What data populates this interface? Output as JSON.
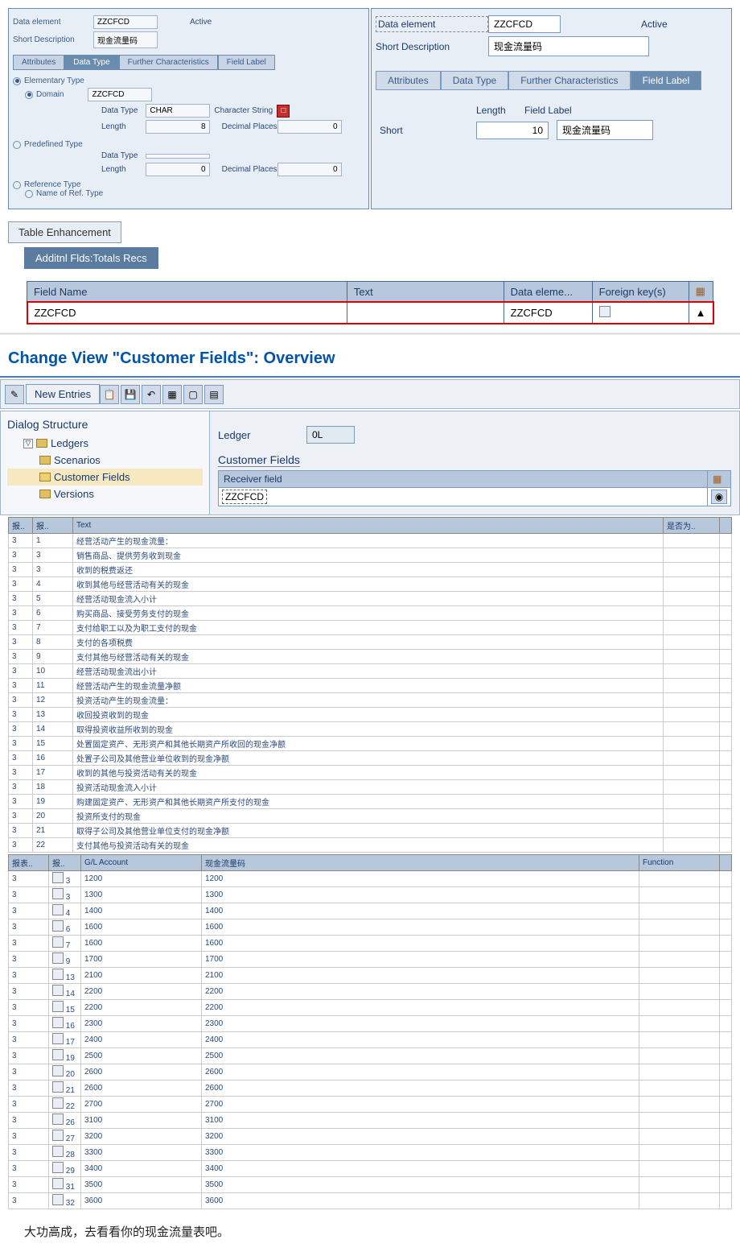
{
  "left_panel": {
    "data_element_label": "Data element",
    "data_element_value": "ZZCFCD",
    "active_label": "Active",
    "short_desc_label": "Short Description",
    "short_desc_value": "现金流量码",
    "tabs": [
      "Attributes",
      "Data Type",
      "Further Characteristics",
      "Field Label"
    ],
    "active_tab_index": 1,
    "elementary_type": "Elementary Type",
    "domain": "Domain",
    "domain_value": "ZZCFCD",
    "data_type_label": "Data Type",
    "data_type_value": "CHAR",
    "data_type_text": "Character String",
    "length_label": "Length",
    "length_value": "8",
    "decimal_places": "Decimal Places",
    "decimal_value": "0",
    "predefined_type": "Predefined Type",
    "pred_length_value": "0",
    "pred_decimal_value": "0",
    "reference_type": "Reference Type",
    "name_ref_type": "Name of Ref. Type"
  },
  "right_panel": {
    "data_element_label": "Data element",
    "data_element_value": "ZZCFCD",
    "active_label": "Active",
    "short_desc_label": "Short Description",
    "short_desc_value": "现金流量码",
    "tabs": [
      "Attributes",
      "Data Type",
      "Further Characteristics",
      "Field Label"
    ],
    "active_tab_index": 3,
    "length_label": "Length",
    "field_label_label": "Field Label",
    "short_label": "Short",
    "short_length": "10",
    "short_value": "现金流量码"
  },
  "table_enhancement": {
    "title": "Table Enhancement",
    "button": "Additnl Flds:Totals Recs",
    "headers": {
      "field_name": "Field Name",
      "text": "Text",
      "data_eleme": "Data eleme...",
      "foreign_key": "Foreign key(s)"
    },
    "row": {
      "field_name": "ZZCFCD",
      "data_element": "ZZCFCD"
    }
  },
  "change_view": {
    "title": "Change View \"Customer Fields\": Overview",
    "new_entries": "New Entries",
    "dialog_structure": "Dialog Structure",
    "ledgers": "Ledgers",
    "scenarios": "Scenarios",
    "customer_fields": "Customer Fields",
    "versions": "Versions",
    "ledger_label": "Ledger",
    "ledger_value": "0L",
    "cf_title": "Customer Fields",
    "receiver_field": "Receiver field",
    "receiver_value": "ZZCFCD"
  },
  "text_table1": {
    "headers": [
      "报..",
      "报..",
      "Text",
      "是否为.."
    ],
    "rows": [
      {
        "c1": "3",
        "c2": "1",
        "text": "经营活动产生的现金流量："
      },
      {
        "c1": "3",
        "c2": "3",
        "text": "销售商品、提供劳务收到现金"
      },
      {
        "c1": "3",
        "c2": "3",
        "text": "收到的税费返还"
      },
      {
        "c1": "3",
        "c2": "4",
        "text": "收到其他与经营活动有关的现金"
      },
      {
        "c1": "3",
        "c2": "5",
        "text": "        经营活动现金流入小计"
      },
      {
        "c1": "3",
        "c2": "6",
        "text": "购买商品、接受劳务支付的现金"
      },
      {
        "c1": "3",
        "c2": "7",
        "text": "支付给职工以及为职工支付的现金"
      },
      {
        "c1": "3",
        "c2": "8",
        "text": "支付的各项税费"
      },
      {
        "c1": "3",
        "c2": "9",
        "text": "支付其他与经营活动有关的现金"
      },
      {
        "c1": "3",
        "c2": "10",
        "text": "        经营活动现金流出小计"
      },
      {
        "c1": "3",
        "c2": "11",
        "text": "    经营活动产生的现金流量净额"
      },
      {
        "c1": "3",
        "c2": "12",
        "text": "投资活动产生的现金流量："
      },
      {
        "c1": "3",
        "c2": "13",
        "text": "收回投资收到的现金"
      },
      {
        "c1": "3",
        "c2": "14",
        "text": "取得投资收益所收到的现金"
      },
      {
        "c1": "3",
        "c2": "15",
        "text": "处置固定资产、无形资产和其他长期资产所收回的现金净额"
      },
      {
        "c1": "3",
        "c2": "16",
        "text": "处置子公司及其他营业单位收到的现金净额"
      },
      {
        "c1": "3",
        "c2": "17",
        "text": "收到的其他与投资活动有关的现金"
      },
      {
        "c1": "3",
        "c2": "18",
        "text": "        投资活动现金流入小计"
      },
      {
        "c1": "3",
        "c2": "19",
        "text": "购建固定资产、无形资产和其他长期资产所支付的现金"
      },
      {
        "c1": "3",
        "c2": "20",
        "text": "投资所支付的现金"
      },
      {
        "c1": "3",
        "c2": "21",
        "text": "取得子公司及其他营业单位支付的现金净额"
      },
      {
        "c1": "3",
        "c2": "22",
        "text": "支付其他与投资活动有关的现金"
      }
    ]
  },
  "text_table2": {
    "headers": [
      "报表..",
      "报..",
      "G/L Account",
      "现金流量码",
      "Function"
    ],
    "rows": [
      {
        "c1": "3",
        "c2": "3",
        "gl": "1200",
        "cf": "1200"
      },
      {
        "c1": "3",
        "c2": "3",
        "gl": "1300",
        "cf": "1300"
      },
      {
        "c1": "3",
        "c2": "4",
        "gl": "1400",
        "cf": "1400"
      },
      {
        "c1": "3",
        "c2": "6",
        "gl": "1600",
        "cf": "1600"
      },
      {
        "c1": "3",
        "c2": "7",
        "gl": "1600",
        "cf": "1600"
      },
      {
        "c1": "3",
        "c2": "9",
        "gl": "1700",
        "cf": "1700"
      },
      {
        "c1": "3",
        "c2": "13",
        "gl": "2100",
        "cf": "2100"
      },
      {
        "c1": "3",
        "c2": "14",
        "gl": "2200",
        "cf": "2200"
      },
      {
        "c1": "3",
        "c2": "15",
        "gl": "2200",
        "cf": "2200"
      },
      {
        "c1": "3",
        "c2": "16",
        "gl": "2300",
        "cf": "2300"
      },
      {
        "c1": "3",
        "c2": "17",
        "gl": "2400",
        "cf": "2400"
      },
      {
        "c1": "3",
        "c2": "19",
        "gl": "2500",
        "cf": "2500"
      },
      {
        "c1": "3",
        "c2": "20",
        "gl": "2600",
        "cf": "2600"
      },
      {
        "c1": "3",
        "c2": "21",
        "gl": "2600",
        "cf": "2600"
      },
      {
        "c1": "3",
        "c2": "22",
        "gl": "2700",
        "cf": "2700"
      },
      {
        "c1": "3",
        "c2": "26",
        "gl": "3100",
        "cf": "3100"
      },
      {
        "c1": "3",
        "c2": "27",
        "gl": "3200",
        "cf": "3200"
      },
      {
        "c1": "3",
        "c2": "28",
        "gl": "3300",
        "cf": "3300"
      },
      {
        "c1": "3",
        "c2": "29",
        "gl": "3400",
        "cf": "3400"
      },
      {
        "c1": "3",
        "c2": "31",
        "gl": "3500",
        "cf": "3500"
      },
      {
        "c1": "3",
        "c2": "32",
        "gl": "3600",
        "cf": "3600"
      }
    ]
  },
  "footer": "大功高成，去看看你的现金流量表吧。"
}
